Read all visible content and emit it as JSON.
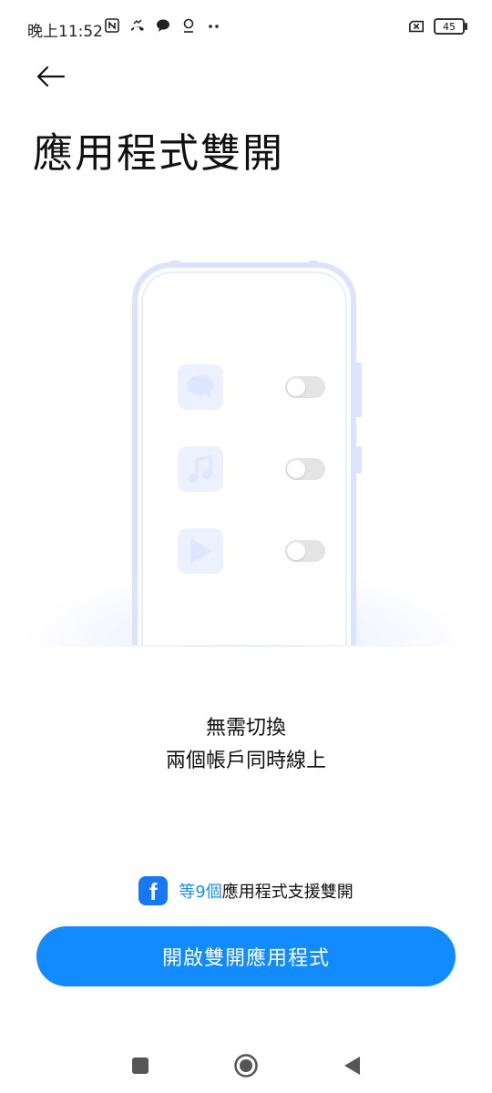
{
  "status_bar": {
    "time": "晚上11:52",
    "battery_level": "45",
    "icons": [
      "nfc-icon",
      "missed-call-icon",
      "chat-bubble-icon",
      "location-pin-icon",
      "more-dots-icon",
      "no-sim-icon",
      "battery-icon"
    ]
  },
  "header": {
    "title": "應用程式雙開"
  },
  "illustration": {
    "apps": [
      "chat-app-icon",
      "music-app-icon",
      "video-app-icon"
    ]
  },
  "tagline": {
    "line1": "無需切換",
    "line2": "兩個帳戶同時線上"
  },
  "support": {
    "highlight": "等9個",
    "rest": "應用程式支援雙開",
    "icon": "facebook-icon"
  },
  "primary_button": {
    "label": "開啟雙開應用程式"
  },
  "nav_bar": {
    "items": [
      "recents-button",
      "home-button",
      "back-nav-button"
    ]
  },
  "colors": {
    "accent": "#118bff",
    "highlight_text": "#1a8cff",
    "illustration_tint": "#dbe3ff"
  }
}
